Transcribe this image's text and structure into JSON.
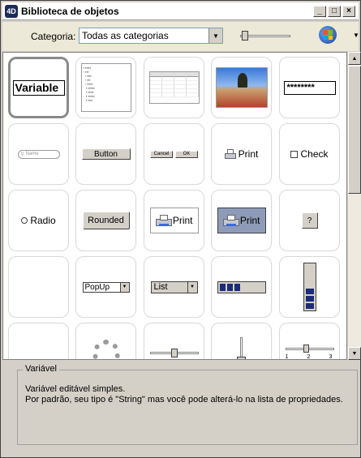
{
  "window": {
    "title": "Biblioteca de objetos",
    "app_icon_text": "4D",
    "min_glyph": "_",
    "max_glyph": "□",
    "close_glyph": "×"
  },
  "toolbar": {
    "category_label": "Categoria:",
    "category_value": "Todas as categorias",
    "icons": [
      "dropdown-arrow-icon",
      "zoom-slider",
      "windows-logo-icon",
      "menu-caret-icon"
    ]
  },
  "objects": [
    {
      "name": "variable",
      "label": "Variable",
      "selected": true
    },
    {
      "name": "hierarchical-list",
      "label": ""
    },
    {
      "name": "listbox",
      "label": ""
    },
    {
      "name": "picture",
      "label": ""
    },
    {
      "name": "password",
      "label": "********"
    },
    {
      "name": "search-field",
      "label": "Name"
    },
    {
      "name": "button",
      "label": "Button"
    },
    {
      "name": "ok-cancel",
      "label_cancel": "Cancel",
      "label_ok": "OK"
    },
    {
      "name": "print-small",
      "label": "Print"
    },
    {
      "name": "checkbox",
      "label": "Check"
    },
    {
      "name": "radio",
      "label": "Radio"
    },
    {
      "name": "rounded-button",
      "label": "Rounded"
    },
    {
      "name": "print-bevel",
      "label": "Print"
    },
    {
      "name": "print-selected",
      "label": "Print"
    },
    {
      "name": "help-button",
      "label": "?"
    },
    {
      "name": "empty",
      "label": ""
    },
    {
      "name": "popup",
      "label": "PopUp"
    },
    {
      "name": "dropdown-list",
      "label": "List"
    },
    {
      "name": "hprogress",
      "label": ""
    },
    {
      "name": "vprogress",
      "label": ""
    },
    {
      "name": "hprogress-2",
      "label": ""
    },
    {
      "name": "spinner",
      "label": ""
    },
    {
      "name": "hslider",
      "label": ""
    },
    {
      "name": "vslider",
      "label": ""
    },
    {
      "name": "ruler",
      "label": "",
      "ticks": [
        "1",
        "2",
        "3"
      ]
    }
  ],
  "description": {
    "title": "Variável",
    "line1": "Variável editável simples.",
    "line2": "Por padrão, seu tipo é \"String\" mas você pode alterá-lo na lista de propriedades."
  },
  "colors": {
    "accent": "#1c2b7a",
    "window_bg": "#d4d0c8"
  }
}
